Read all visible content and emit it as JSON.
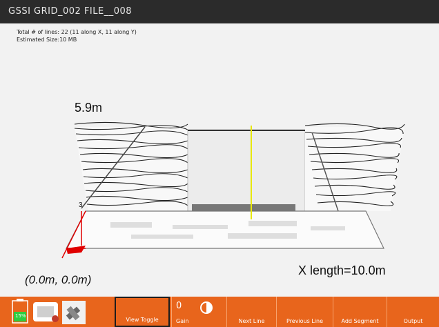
{
  "window": {
    "title": "GSSI   GRID_002   FILE__008"
  },
  "info": {
    "total_lines": "Total # of lines: 22 (11 along X, 11 along Y)",
    "estimated_size": "Estimated Size:10 MB"
  },
  "view": {
    "depth_label": "5.9m",
    "origin_label": "(0.0m, 0.0m)",
    "x_length_label": "X length=10.0m",
    "axis_tick_label": "3"
  },
  "status": {
    "battery_percent": "15%"
  },
  "toolbar": {
    "view_toggle": "View Toggle",
    "gain_value": "0",
    "gain": "Gain",
    "next_line": "Next Line",
    "previous_line": "Previous Line",
    "add_segment": "Add Segment",
    "output": "Output"
  },
  "colors": {
    "accent": "#e8651c",
    "title_bg": "#2b2b2b",
    "cursor": "#e8e800",
    "axis": "#e00000"
  }
}
